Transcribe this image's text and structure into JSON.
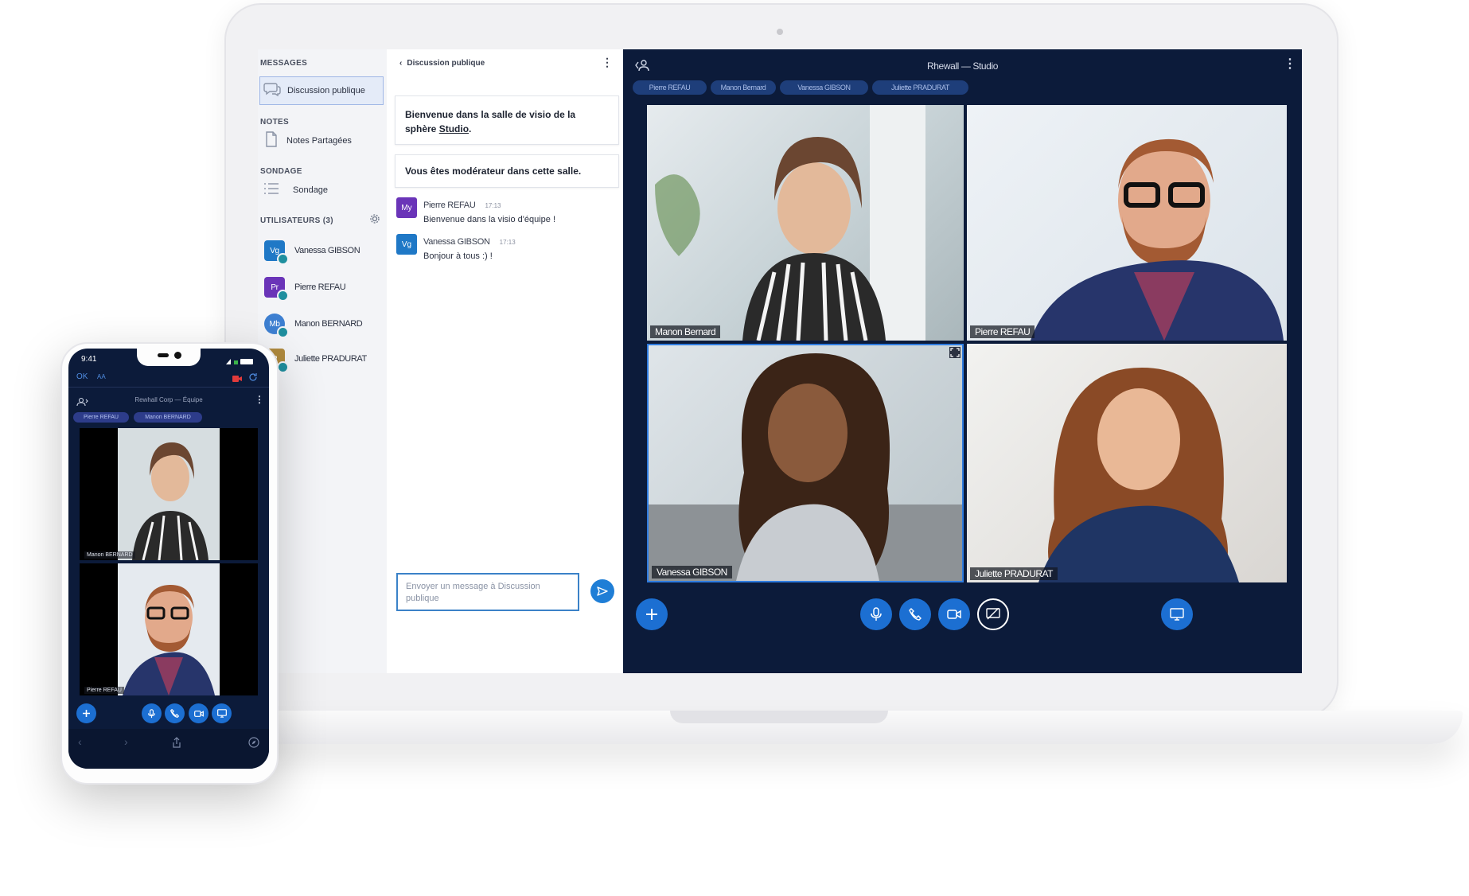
{
  "sidebar": {
    "messages_title": "MESSAGES",
    "messages_item": "Discussion publique",
    "notes_title": "NOTES",
    "notes_item": "Notes Partagées",
    "sondage_title": "SONDAGE",
    "sondage_item": "Sondage",
    "users_title": "UTILISATEURS (3)",
    "users": [
      {
        "initials": "Vg",
        "name": "Vanessa GIBSON",
        "color": "#1f78c6"
      },
      {
        "initials": "Pr",
        "name": "Pierre REFAU",
        "color": "#6a34b8"
      },
      {
        "initials": "Mb",
        "name": "Manon BERNARD",
        "color": "#3d7fd1"
      },
      {
        "initials": "P",
        "name": "Juliette PRADURAT",
        "color": "#b08a3e"
      }
    ]
  },
  "chat": {
    "header": "Discussion publique",
    "welcome_text": "Bienvenue dans la salle de visio de la sphère",
    "welcome_link": "Studio",
    "welcome_end": ".",
    "moderator_text": "Vous êtes modérateur dans cette salle.",
    "messages": [
      {
        "initials": "My",
        "name": "Pierre REFAU",
        "time": "17:13",
        "text": "Bienvenue dans la visio d'équipe !",
        "color": "#6a34b8"
      },
      {
        "initials": "Vg",
        "name": "Vanessa GIBSON",
        "time": "17:13",
        "text": "Bonjour à tous :) !",
        "color": "#1f78c6"
      }
    ],
    "input_placeholder": "Envoyer un message à Discussion publique"
  },
  "studio": {
    "title": "Rhewall — Studio",
    "chips": [
      "Pierre REFAU",
      "Manon Bernard",
      "Vanessa GIBSON",
      "Juliette PRADURAT"
    ],
    "tiles": [
      {
        "label": "Manon Bernard"
      },
      {
        "label": "Pierre REFAU"
      },
      {
        "label": "Vanessa GIBSON"
      },
      {
        "label": "Juliette PRADURAT"
      }
    ]
  },
  "phone": {
    "time": "9:41",
    "ok": "OK",
    "text_size": "AA",
    "title": "Rewhall Corp — Équipe",
    "chips": [
      "Pierre REFAU",
      "Manon BERNARD"
    ],
    "tiles": [
      {
        "label": "Manon BERNARD"
      },
      {
        "label": "Pierre REFAU"
      }
    ]
  }
}
